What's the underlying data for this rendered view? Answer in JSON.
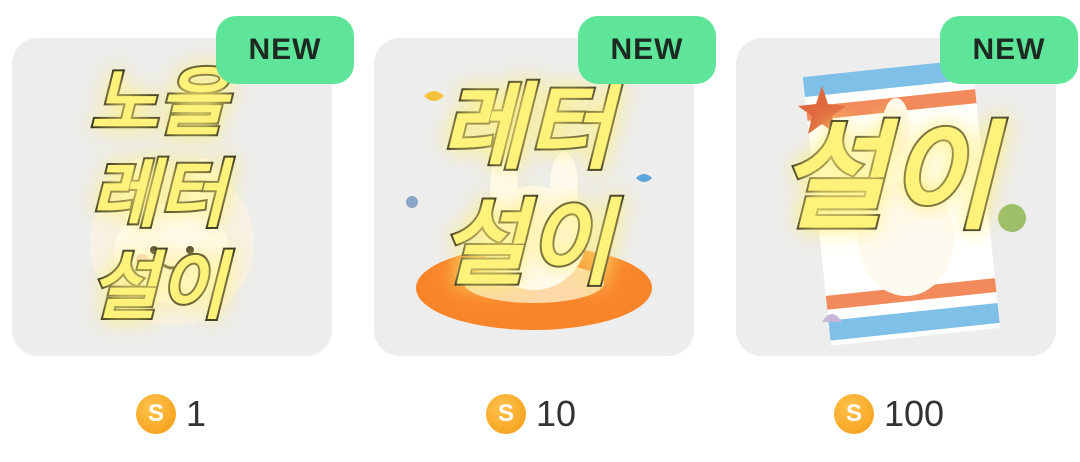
{
  "items": [
    {
      "badge": "NEW",
      "caption_lines": [
        "노을",
        "레터",
        "설이"
      ],
      "currency_symbol": "S",
      "price": "1"
    },
    {
      "badge": "NEW",
      "caption_lines": [
        "레터",
        "설이"
      ],
      "currency_symbol": "S",
      "price": "10"
    },
    {
      "badge": "NEW",
      "caption_lines": [
        "설이"
      ],
      "currency_symbol": "S",
      "price": "100"
    }
  ],
  "icons": {
    "coin": "coin-icon",
    "art0": "bunny-sunset-icon",
    "art1": "bunny-swim-ring-icon",
    "art2": "bunny-beach-towel-icon"
  },
  "colors": {
    "badge_bg": "#5fe59a",
    "thumb_bg": "#ededed",
    "coin": "#f5a623",
    "caption_fill": "#fff27a"
  }
}
